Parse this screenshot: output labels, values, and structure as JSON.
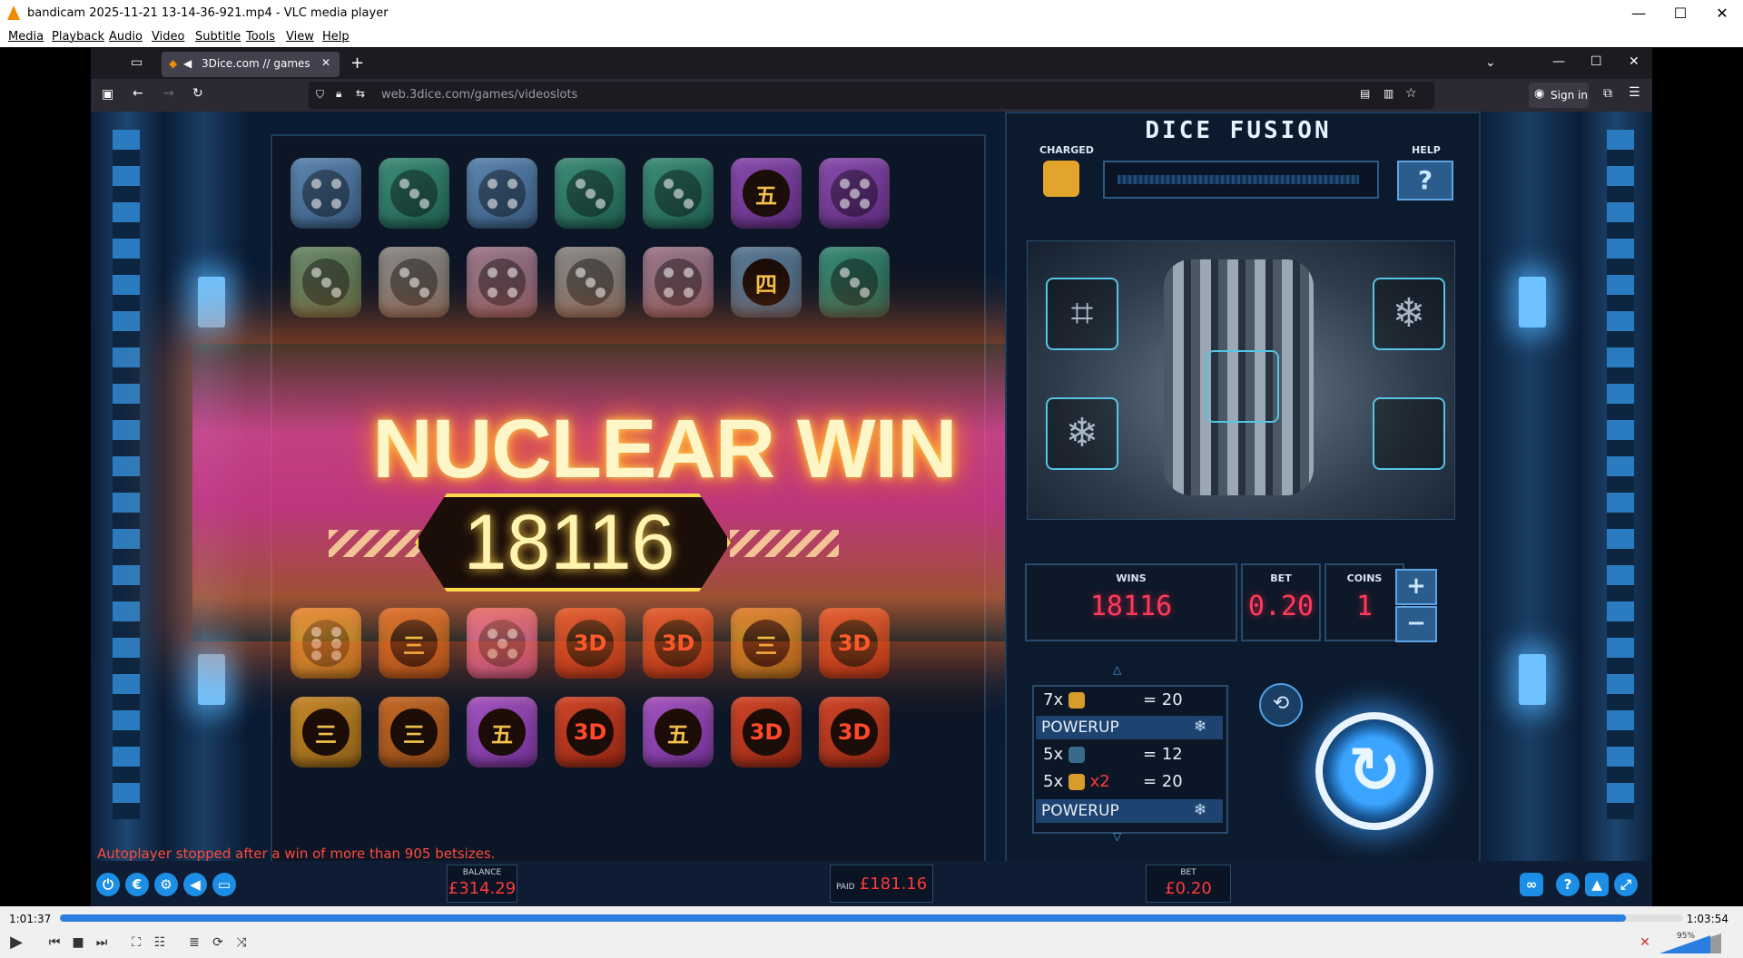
{
  "window": {
    "title": "bandicam 2025-11-21 13-14-36-921.mp4 - VLC media player"
  },
  "menu": [
    "Media",
    "Playback",
    "Audio",
    "Video",
    "Subtitle",
    "Tools",
    "View",
    "Help"
  ],
  "browser": {
    "tab_title": "3Dice.com // games",
    "url": "web.3dice.com/games/videoslots",
    "signin_label": "Sign in"
  },
  "game": {
    "board": {
      "rows": [
        [
          {
            "color": "blue",
            "face": "4"
          },
          {
            "color": "green",
            "face": "3"
          },
          {
            "color": "blue",
            "face": "4"
          },
          {
            "color": "green",
            "face": "3"
          },
          {
            "color": "green",
            "face": "3"
          },
          {
            "color": "purple",
            "face": "五"
          },
          {
            "color": "purple",
            "face": "5"
          }
        ],
        [
          {
            "color": "sage",
            "face": "3"
          },
          {
            "color": "gray",
            "face": "3"
          },
          {
            "color": "rose",
            "face": "4"
          },
          {
            "color": "gray",
            "face": "3"
          },
          {
            "color": "rose",
            "face": "4"
          },
          {
            "color": "steel",
            "face": "四"
          },
          {
            "color": "green",
            "face": "3"
          }
        ],
        [
          {
            "color": "gold",
            "face": "6"
          },
          {
            "color": "orange",
            "face": "三"
          },
          {
            "color": "pink",
            "face": "5"
          },
          {
            "color": "red",
            "face": "3D"
          },
          {
            "color": "red",
            "face": "3D"
          },
          {
            "color": "amber",
            "face": "三"
          },
          {
            "color": "red",
            "face": "3D"
          }
        ],
        [
          {
            "color": "amber",
            "face": "三"
          },
          {
            "color": "orange",
            "face": "三"
          },
          {
            "color": "violet",
            "face": "五"
          },
          {
            "color": "red",
            "face": "3D"
          },
          {
            "color": "violet",
            "face": "五"
          },
          {
            "color": "red",
            "face": "3D"
          },
          {
            "color": "red",
            "face": "3D"
          }
        ]
      ]
    },
    "banner": {
      "title": "NUCLEAR WIN",
      "amount": "18116"
    },
    "panel": {
      "title": "DICE FUSION",
      "charged_label": "CHARGED",
      "help_label": "HELP",
      "help_glyph": "?",
      "wins_label": "WINS",
      "wins_value": "18116",
      "bet_label": "BET",
      "bet_value": "0.20",
      "coins_label": "COINS",
      "coins_value": "1",
      "plus": "+",
      "minus": "−"
    },
    "paytable": [
      {
        "count": "7x",
        "multiplier": "",
        "value": "= 20"
      },
      {
        "powerup": "POWERUP"
      },
      {
        "count": "5x",
        "multiplier": "",
        "value": "= 12"
      },
      {
        "count": "5x",
        "multiplier": "x2",
        "value": "= 20"
      },
      {
        "powerup": "POWERUP"
      }
    ],
    "status_message": "Autoplayer stopped after a win of more than 905 betsizes.",
    "balance_label": "BALANCE",
    "balance_value": "£314.29",
    "paid_label": "PAID",
    "paid_value": "£181.16",
    "bet_label": "BET",
    "bet_value": "£0.20"
  },
  "player": {
    "time_current": "1:01:37",
    "time_total": "1:03:54",
    "progress": 0.965,
    "volume": "95%"
  },
  "colors": {
    "accent": "#2a7ee0",
    "win_red": "#ff3a5a",
    "vlc_orange": "#f08a00"
  }
}
